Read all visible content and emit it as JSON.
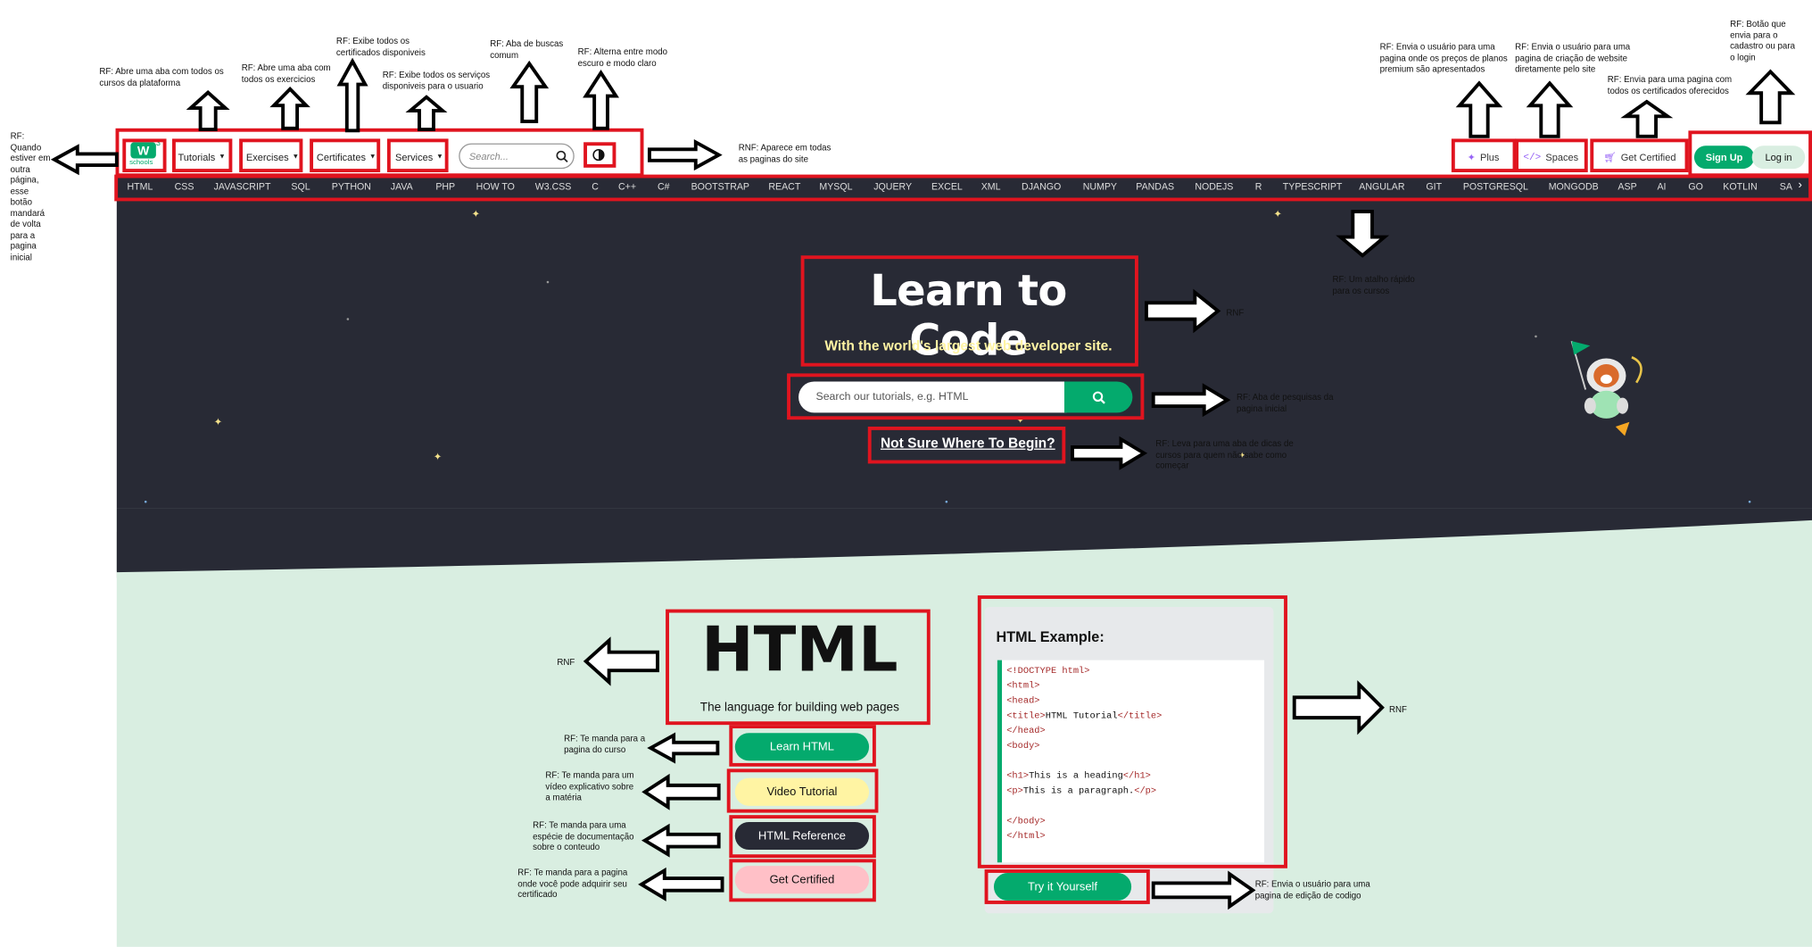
{
  "annotations": {
    "home": [
      "RF:",
      "Quando",
      "estiver em",
      "outra",
      "página,",
      "esse",
      "botão",
      "mandará",
      "de volta",
      "para a",
      "pagina",
      "inicial"
    ],
    "tutorials": [
      "RF: Abre uma aba com todos os",
      "cursos da plataforma"
    ],
    "exercises": [
      "RF: Abre uma aba com",
      "todos os exercicios"
    ],
    "certificates": [
      "RF: Exibe todos os",
      "certificados disponiveis"
    ],
    "services": [
      "RF: Exibe todos os serviços",
      "disponiveis para o usuario"
    ],
    "search": [
      "RF: Aba de buscas",
      "comum"
    ],
    "theme": [
      "RF: Alterna entre modo",
      "escuro e modo claro"
    ],
    "topbar_rnf": [
      "RNF: Aparece em todas",
      "as paginas do site"
    ],
    "plus": [
      "RF: Envia o usuário para uma",
      "pagina onde os preços de planos",
      "premium são apresentados"
    ],
    "spaces": [
      "RF: Envia o usuário para uma",
      "pagina de criação de website",
      "diretamente pelo site"
    ],
    "get_certified": [
      "RF: Envia para uma pagina com",
      "todos os certificados oferecidos"
    ],
    "signup": [
      "RF: Botão que",
      "envia para o",
      "cadastro ou para",
      "o login"
    ],
    "shortcut": [
      "RF: Um atalho rápido",
      "para os cursos"
    ],
    "hero_rnf": [
      "RNF"
    ],
    "hero_search": [
      "RF: Aba de pesquisas da",
      "pagina inicial"
    ],
    "not_sure": [
      "RF: Leva para uma aba de dicas de",
      "cursos para quem não sabe como",
      "começar"
    ],
    "html_rnf": [
      "RNF"
    ],
    "learn": [
      "RF: Te manda para a",
      "pagina do curso"
    ],
    "video": [
      "RF: Te manda para um",
      "vídeo explicativo sobre",
      "a matéria"
    ],
    "reference": [
      "RF: Te manda para uma",
      "espécie de documentação",
      "sobre o conteudo"
    ],
    "certified": [
      "RF: Te manda para a pagina",
      "onde você pode adquirir seu",
      "certificado"
    ],
    "example_rnf": [
      "RNF"
    ],
    "try": [
      "RF: Envia o usuário para uma",
      "pagina de edição de codigo"
    ]
  },
  "topbar": {
    "logo_text": "schools",
    "logo_sup": "3",
    "tutorials": "Tutorials",
    "exercises": "Exercises",
    "certificates": "Certificates",
    "services": "Services",
    "search_placeholder": "Search...",
    "plus": "Plus",
    "spaces": "Spaces",
    "get_certified": "Get Certified",
    "sign_up": "Sign Up",
    "log_in": "Log in"
  },
  "subnav": [
    "HTML",
    "CSS",
    "JAVASCRIPT",
    "SQL",
    "PYTHON",
    "JAVA",
    "PHP",
    "HOW TO",
    "W3.CSS",
    "C",
    "C++",
    "C#",
    "BOOTSTRAP",
    "REACT",
    "MYSQL",
    "JQUERY",
    "EXCEL",
    "XML",
    "DJANGO",
    "NUMPY",
    "PANDAS",
    "NODEJS",
    "R",
    "TYPESCRIPT",
    "ANGULAR",
    "GIT",
    "POSTGRESQL",
    "MONGODB",
    "ASP",
    "AI",
    "GO",
    "KOTLIN",
    "SA"
  ],
  "hero": {
    "title": "Learn to Code",
    "subtitle": "With the world's largest web developer site.",
    "search_placeholder": "Search our tutorials, e.g. HTML",
    "link": "Not Sure Where To Begin?"
  },
  "html_section": {
    "title": "HTML",
    "subtitle": "The language for building web pages",
    "learn": "Learn HTML",
    "video": "Video Tutorial",
    "reference": "HTML Reference",
    "certified": "Get Certified"
  },
  "example": {
    "title": "HTML Example:",
    "code": [
      [
        [
          "tag",
          "<!DOCTYPE html>"
        ]
      ],
      [
        [
          "tag",
          "<html>"
        ]
      ],
      [
        [
          "tag",
          "<head>"
        ]
      ],
      [
        [
          "tag",
          "<title>"
        ],
        [
          "txt",
          "HTML Tutorial"
        ],
        [
          "tag",
          "</title>"
        ]
      ],
      [
        [
          "tag",
          "</head>"
        ]
      ],
      [
        [
          "tag",
          "<body>"
        ]
      ],
      [],
      [
        [
          "tag",
          "<h1>"
        ],
        [
          "txt",
          "This is a heading"
        ],
        [
          "tag",
          "</h1>"
        ]
      ],
      [
        [
          "tag",
          "<p>"
        ],
        [
          "txt",
          "This is a paragraph."
        ],
        [
          "tag",
          "</p>"
        ]
      ],
      [],
      [
        [
          "tag",
          "</body>"
        ]
      ],
      [
        [
          "tag",
          "</html>"
        ]
      ]
    ],
    "try": "Try it Yourself"
  },
  "colors": {
    "brand_green": "#04aa6d",
    "dark": "#282a35",
    "annotation_red": "#e0141f",
    "yellow_btn": "#fff4a3",
    "pink_btn": "#ffc0c7",
    "light_bg": "#d9eee1"
  }
}
